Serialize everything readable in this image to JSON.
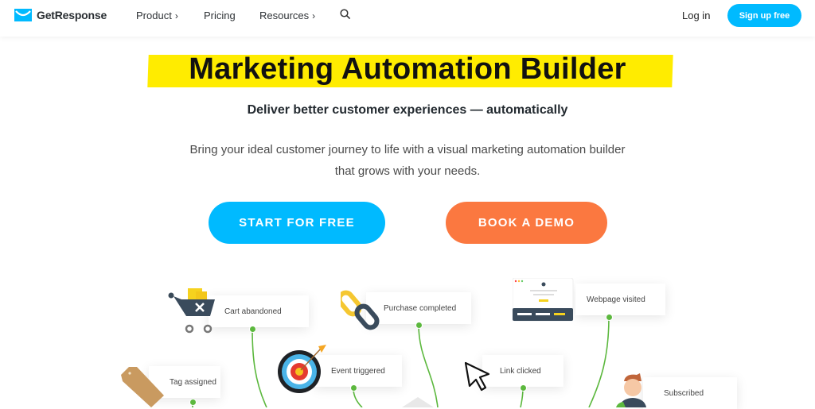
{
  "nav": {
    "brand": "GetResponse",
    "items": [
      {
        "label": "Product",
        "has_submenu": true
      },
      {
        "label": "Pricing",
        "has_submenu": false
      },
      {
        "label": "Resources",
        "has_submenu": true
      }
    ],
    "search_icon": "search-icon",
    "login_label": "Log in",
    "signup_label": "Sign up free"
  },
  "hero": {
    "title": "Marketing Automation Builder",
    "subtitle": "Deliver better customer experiences — automatically",
    "description_line1": "Bring your ideal customer journey to life with a visual marketing automation builder",
    "description_line2": "that grows with your needs.",
    "cta_primary": "START FOR FREE",
    "cta_secondary": "BOOK A DEMO"
  },
  "workflow": {
    "nodes": [
      {
        "label": "Cart abandoned",
        "icon": "cart-icon"
      },
      {
        "label": "Purchase completed",
        "icon": "chain-link-icon"
      },
      {
        "label": "Webpage visited",
        "icon": "webpage-icon"
      },
      {
        "label": "Tag assigned",
        "icon": "tag-icon"
      },
      {
        "label": "Event triggered",
        "icon": "target-icon"
      },
      {
        "label": "Link clicked",
        "icon": "cursor-icon"
      },
      {
        "label": "Subscribed",
        "icon": "person-icon"
      }
    ]
  },
  "colors": {
    "brand_blue": "#00baff",
    "demo_orange": "#fb7840",
    "highlight_yellow": "#ffec00",
    "connector_green": "#5cb83e"
  }
}
